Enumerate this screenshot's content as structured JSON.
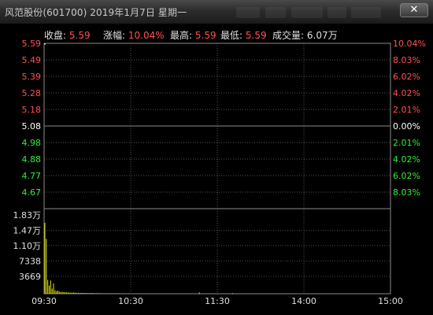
{
  "window": {
    "title": "风范股份(601700)  2019年1月7日  星期一",
    "close_symbol": "✕"
  },
  "header": {
    "close_label": "收盘:",
    "close_value": "5.59",
    "change_label": "涨幅:",
    "change_value": "10.04%",
    "high_label": "最高:",
    "high_value": "5.59",
    "low_label": "最低:",
    "low_value": "5.59",
    "volume_label": "成交量:",
    "volume_value": "6.07万"
  },
  "colors": {
    "up": "#ff5050",
    "down": "#33ee33",
    "flat": "#ffffff",
    "volume": "#e6e600",
    "grid": "#9a9a9a",
    "border": "#8a8a8a"
  },
  "chart_data": {
    "type": "line",
    "price_axis": {
      "left_labels": [
        "5.59",
        "5.49",
        "5.39",
        "5.28",
        "5.18",
        "5.08",
        "4.98",
        "4.88",
        "4.77",
        "4.67"
      ],
      "right_labels": [
        "10.04%",
        "8.03%",
        "6.02%",
        "4.02%",
        "2.01%",
        "0.00%",
        "2.01%",
        "4.02%",
        "6.02%",
        "8.03%"
      ],
      "ylim": [
        4.57,
        5.59
      ],
      "prev_close": 5.08
    },
    "series": [
      {
        "values": [
          5.59,
          5.59
        ]
      }
    ],
    "volume_axis": {
      "labels": [
        "1.83万",
        "1.47万",
        "1.10万",
        "7338",
        "3669"
      ],
      "ylim": [
        0,
        18345
      ]
    },
    "volume_values": [
      16500,
      12800,
      3200,
      1900,
      3100,
      1200,
      2400,
      800,
      600,
      700,
      500,
      400,
      450,
      380,
      350,
      300,
      320,
      280,
      260,
      240,
      300,
      220,
      200,
      210,
      180,
      170,
      190,
      160,
      150,
      170,
      140,
      150,
      160,
      130,
      140,
      120,
      110,
      130,
      120,
      100,
      110,
      95,
      105,
      90,
      100,
      85,
      95,
      80,
      90,
      85,
      80,
      75,
      85,
      70,
      80,
      75,
      70,
      65,
      75,
      60,
      70,
      65,
      60,
      55,
      65,
      60,
      55,
      50,
      60,
      55,
      50,
      45,
      55,
      50,
      45,
      50,
      40,
      45,
      50,
      40,
      45,
      40,
      35,
      45,
      40,
      35,
      40,
      30,
      35,
      40,
      30,
      35,
      30,
      40,
      35,
      30,
      35,
      30,
      25,
      35,
      30,
      25,
      30,
      35,
      30,
      25,
      30,
      300,
      25,
      30,
      25,
      30,
      25,
      20,
      30,
      25,
      20,
      25,
      30,
      25,
      20,
      25,
      20,
      30,
      25,
      20,
      25,
      20,
      25,
      20,
      150,
      25,
      20,
      25,
      20,
      25,
      20,
      25,
      20,
      20,
      25,
      20,
      25,
      20,
      25,
      20,
      25,
      20,
      20,
      25,
      20,
      25,
      20,
      25,
      20,
      25,
      20,
      20,
      25,
      20,
      25,
      20,
      25,
      20,
      25,
      20,
      20,
      25,
      20,
      25,
      20,
      25,
      20,
      25,
      20,
      20,
      25,
      20,
      25,
      20,
      25,
      20,
      25,
      20,
      20,
      25,
      20,
      25,
      20,
      25,
      20,
      25,
      20,
      20,
      25,
      20,
      25,
      20,
      25,
      20,
      25,
      20,
      20,
      25,
      20,
      25,
      20,
      25,
      20,
      25,
      20,
      20,
      25,
      20,
      25,
      20,
      25,
      20,
      25,
      20,
      20,
      25,
      20,
      25,
      20,
      25,
      20,
      25,
      20,
      20,
      25,
      20,
      25,
      20,
      25,
      20,
      25,
      20,
      20,
      25,
      20,
      25,
      20,
      25,
      20,
      25,
      20,
      20,
      25,
      20,
      25,
      20,
      25,
      20,
      25,
      20,
      20,
      25,
      20,
      25,
      20,
      25,
      20,
      25,
      20,
      20,
      25,
      20,
      25,
      20,
      25,
      20,
      25,
      20,
      20,
      25,
      20,
      25,
      20,
      25,
      20,
      25,
      20,
      20,
      25,
      20,
      25,
      20,
      25,
      20,
      25,
      20,
      20,
      25,
      20,
      25,
      20,
      25,
      20,
      25,
      20,
      20,
      25,
      20,
      25,
      20,
      25,
      20,
      25,
      20,
      20,
      25,
      20,
      25,
      20,
      25,
      20,
      25,
      20,
      20,
      25,
      20,
      25,
      20,
      25,
      20,
      25,
      20,
      20,
      25,
      20,
      25,
      20,
      25,
      20,
      25,
      20,
      20,
      25,
      20,
      25,
      20,
      25,
      20,
      25,
      20,
      20,
      25,
      20,
      25,
      20,
      25,
      20,
      25,
      20,
      20,
      25,
      20,
      25,
      20,
      25,
      20,
      25,
      20,
      20,
      25,
      20,
      25,
      20,
      25,
      20,
      25,
      20,
      20,
      25,
      20,
      25,
      20,
      25,
      20,
      25,
      20,
      20,
      25,
      20,
      25,
      20,
      25,
      20,
      25,
      20,
      20,
      25,
      20,
      25,
      20,
      25,
      20,
      25,
      20,
      20,
      25,
      20,
      25,
      20,
      25,
      20,
      25,
      20,
      20,
      25,
      20,
      25,
      20,
      25,
      20,
      25,
      20,
      20,
      25,
      20,
      25,
      20,
      25,
      20,
      25,
      20,
      20,
      25,
      20,
      25,
      20,
      25,
      20,
      25,
      20,
      20,
      25,
      20,
      25,
      20,
      25,
      20,
      25,
      20,
      20,
      25,
      20,
      25,
      20,
      25,
      20,
      25,
      20,
      20,
      25,
      20,
      25,
      20,
      25,
      20,
      25,
      20,
      20,
      25,
      20,
      25,
      20,
      25,
      20,
      25,
      20,
      20,
      25,
      20,
      25,
      20,
      25,
      20,
      25,
      20,
      20,
      25,
      20,
      25,
      20,
      25,
      20,
      25,
      20,
      20,
      25,
      20,
      25,
      20,
      25,
      20,
      25,
      20,
      20,
      25,
      20,
      25,
      20,
      25,
      20,
      25,
      20,
      20,
      25,
      20,
      25,
      20,
      25,
      20,
      25,
      20,
      20,
      25,
      20,
      25,
      20,
      25,
      20,
      25,
      20,
      20,
      25,
      20,
      25,
      20,
      25,
      20,
      25,
      20,
      20,
      25,
      20,
      25,
      20,
      25,
      20,
      25,
      20,
      20,
      25,
      20,
      25,
      20,
      25,
      20,
      25,
      20,
      20,
      25,
      20,
      25,
      20,
      25,
      20,
      25,
      20,
      20,
      25,
      20,
      25,
      20,
      25,
      20,
      25,
      20,
      20,
      25,
      20,
      25,
      20,
      25,
      20,
      25,
      20,
      20,
      25,
      20,
      25,
      20,
      25,
      20,
      25,
      20,
      20,
      25,
      20,
      25,
      20,
      25,
      20,
      25,
      20,
      20,
      25,
      20,
      25,
      20,
      25,
      20,
      25,
      20,
      20,
      25,
      20,
      25,
      20,
      25,
      20,
      25,
      20,
      20,
      25,
      20,
      25,
      20,
      25,
      20,
      25,
      20,
      20,
      25,
      20,
      25,
      20,
      25,
      20,
      25,
      20,
      20,
      25,
      20,
      25,
      20,
      25,
      20,
      25,
      20,
      20,
      25,
      20,
      25,
      20,
      25,
      20,
      25,
      20,
      20,
      25,
      20,
      25,
      20,
      25,
      20,
      25,
      20,
      20,
      25,
      20,
      25,
      20,
      25,
      20,
      25,
      20,
      20,
      25,
      20,
      25,
      20,
      25,
      20,
      25,
      20,
      20,
      25,
      20,
      25,
      20,
      25,
      20,
      25,
      20,
      20,
      25,
      20,
      25,
      20,
      25,
      20,
      25,
      20,
      20,
      25,
      20,
      25,
      20,
      25,
      20,
      25,
      20,
      20,
      25,
      20,
      25,
      20,
      25,
      20,
      25,
      20,
      20,
      25,
      20,
      25,
      20,
      25,
      20,
      25,
      20,
      20,
      25,
      20,
      25,
      20,
      25,
      20,
      25,
      20,
      20,
      25,
      20,
      25,
      20,
      25,
      20,
      25,
      20,
      20,
      25,
      20,
      25,
      20,
      25,
      20,
      25,
      20,
      20,
      25,
      20,
      25,
      20,
      25,
      20,
      25,
      20,
      20,
      25,
      20,
      25,
      20,
      25,
      20,
      25,
      20
    ],
    "x_labels": [
      "09:30",
      "10:30",
      "11:30",
      "14:00",
      "15:00"
    ],
    "grid": true
  }
}
